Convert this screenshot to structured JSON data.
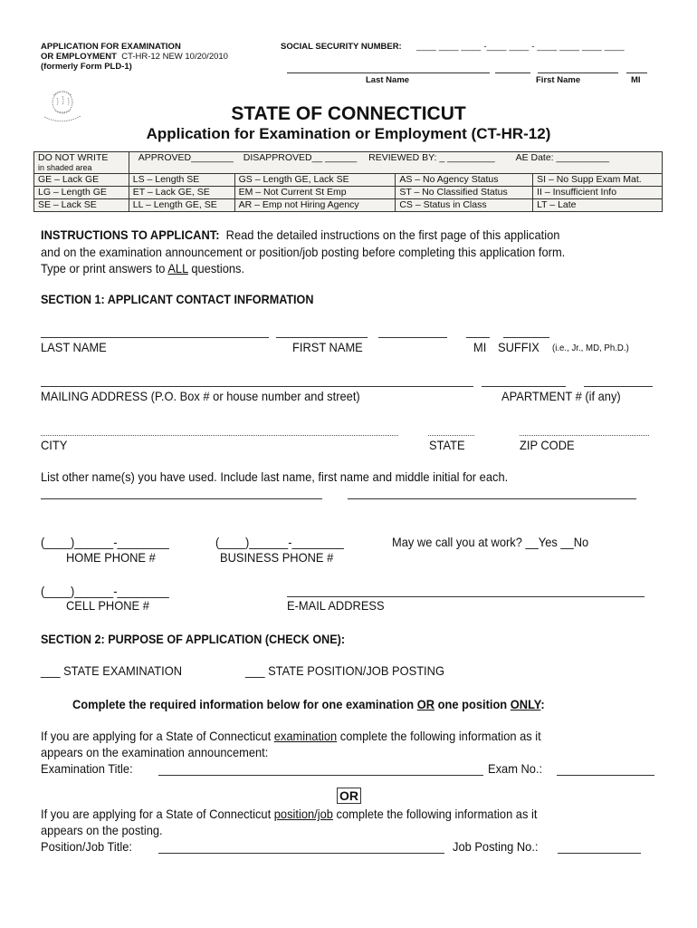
{
  "header": {
    "form_line1": "APPLICATION FOR EXAMINATION",
    "form_line2_bold": "OR EMPLOYMENT",
    "form_line2_rest": "CT-HR-12  NEW 10/20/2010",
    "form_line3": "(formerly Form PLD-1)",
    "ssn_label": "SOCIAL SECURITY NUMBER:",
    "ssn_blanks": "____  ____ ____ -____ ____ - ____  ____  ____  ____",
    "name_labels": {
      "last": "Last Name",
      "first": "First Name",
      "mi": "MI"
    },
    "seal_icon": "state-seal-icon"
  },
  "title": {
    "main": "STATE OF CONNECTICUT",
    "sub": "Application for Examination or Employment (CT-HR-12)"
  },
  "office_table": {
    "row1": {
      "c1a": "DO NOT WRITE",
      "c1b": "in shaded area",
      "approved": "APPROVED________",
      "disapproved": "DISAPPROVED__  ______",
      "reviewed": "REVIEWED BY: _  _________",
      "ae_date": "AE Date: __________"
    },
    "rows": [
      [
        "GE – Lack GE",
        "LS – Length SE",
        "GS – Length GE, Lack SE",
        "AS – No Agency Status",
        "SI –  No Supp Exam Mat."
      ],
      [
        "LG – Length GE",
        "ET – Lack GE, SE",
        "EM – Not Current St Emp",
        "ST – No Classified Status",
        "II – Insufficient Info"
      ],
      [
        "SE – Lack SE",
        "LL – Length GE, SE",
        "AR – Emp not Hiring Agency",
        "CS – Status in Class",
        "LT – Late"
      ]
    ]
  },
  "instructions": {
    "label": "INSTRUCTIONS TO APPLICANT:",
    "line1": "Read the detailed instructions on the first page of this application",
    "line2": "and on the examination announcement or position/job posting before completing this application form.",
    "line3_pre": "Type or print answers to ",
    "line3_u": "ALL",
    "line3_post": " questions."
  },
  "section1": {
    "heading": "SECTION 1:  APPLICANT CONTACT INFORMATION",
    "last_name": "LAST NAME",
    "first_name": "FIRST NAME",
    "mi": "MI",
    "suffix": "SUFFIX",
    "suffix_hint": "(i.e., Jr., MD, Ph.D.)",
    "mailing": "MAILING ADDRESS (P.O. Box # or house number and street)",
    "apartment": "APARTMENT # (if any)",
    "city": "CITY",
    "state": "STATE",
    "zip": "ZIP CODE",
    "other_names": "List other name(s) you have used.  Include last name, first name and middle initial for each.",
    "home_phone_blank": "(____)______-________",
    "home_phone": "HOME PHONE #",
    "business_phone_blank": "(____)______-________",
    "business_phone": "BUSINESS PHONE #",
    "call_at_work": "May we call you at work?  __Yes __No",
    "cell_phone_blank": "(____)______-________",
    "cell_phone": "CELL PHONE #",
    "email": "E-MAIL ADDRESS"
  },
  "section2": {
    "heading": "SECTION 2:  PURPOSE OF APPLICATION (CHECK ONE):",
    "opt_exam": "___ STATE EXAMINATION",
    "opt_job": "___ STATE POSITION/JOB POSTING",
    "complete_pre": "Complete the required information below for one examination ",
    "complete_or": "OR",
    "complete_mid": " one position ",
    "complete_only": "ONLY",
    "complete_post": ":",
    "exam_p1_pre": "If you are applying for a State of Connecticut ",
    "exam_p1_u": "examination",
    "exam_p1_post": " complete the following information as it",
    "exam_p2": "appears on the examination announcement:",
    "exam_title": "Examination Title:",
    "exam_no": "Exam No.:",
    "or": "OR",
    "job_p1_pre": "If you are applying for a State of Connecticut ",
    "job_p1_u": "position/job",
    "job_p1_post": " complete the following information as it",
    "job_p2": "appears on the posting.",
    "job_title": "Position/Job Title:",
    "job_no": "Job Posting No.:"
  }
}
